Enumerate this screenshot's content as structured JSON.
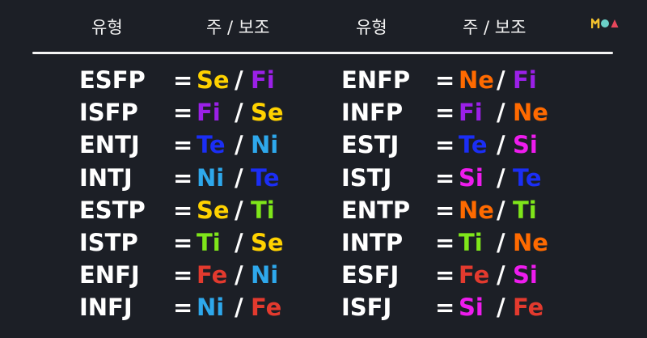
{
  "header": {
    "left_type_label": "유형",
    "left_func_label": "주 / 보조",
    "right_type_label": "유형",
    "right_func_label": "주 / 보조"
  },
  "logo": {
    "icon": "moa-logo-icon",
    "colors": [
      "#f2c12e",
      "#6bd0c8",
      "#e8475b"
    ]
  },
  "function_colors": {
    "Se": "#ffd200",
    "Si": "#ee1cee",
    "Ne": "#ff6a00",
    "Ni": "#2ea8ec",
    "Te": "#1b2ef5",
    "Ti": "#7fe61a",
    "Fe": "#e33a2e",
    "Fi": "#9b20e8"
  },
  "left_column": [
    {
      "type": "ESFP",
      "equals": "=",
      "primary": "Se",
      "separator": "/",
      "auxiliary": "Fi"
    },
    {
      "type": "ISFP",
      "equals": "=",
      "primary": "Fi",
      "separator": "/",
      "auxiliary": "Se"
    },
    {
      "type": "ENTJ",
      "equals": "=",
      "primary": "Te",
      "separator": "/",
      "auxiliary": "Ni"
    },
    {
      "type": "INTJ",
      "equals": "=",
      "primary": "Ni",
      "separator": "/",
      "auxiliary": "Te"
    },
    {
      "type": "ESTP",
      "equals": "=",
      "primary": "Se",
      "separator": "/",
      "auxiliary": "Ti"
    },
    {
      "type": "ISTP",
      "equals": "=",
      "primary": "Ti",
      "separator": "/",
      "auxiliary": "Se"
    },
    {
      "type": "ENFJ",
      "equals": "=",
      "primary": "Fe",
      "separator": "/",
      "auxiliary": "Ni"
    },
    {
      "type": "INFJ",
      "equals": "=",
      "primary": "Ni",
      "separator": "/",
      "auxiliary": "Fe"
    }
  ],
  "right_column": [
    {
      "type": "ENFP",
      "equals": "=",
      "primary": "Ne",
      "separator": "/",
      "auxiliary": "Fi"
    },
    {
      "type": "INFP",
      "equals": "=",
      "primary": "Fi",
      "separator": "/",
      "auxiliary": "Ne"
    },
    {
      "type": "ESTJ",
      "equals": "=",
      "primary": "Te",
      "separator": "/",
      "auxiliary": "Si"
    },
    {
      "type": "ISTJ",
      "equals": "=",
      "primary": "Si",
      "separator": "/",
      "auxiliary": "Te"
    },
    {
      "type": "ENTP",
      "equals": "=",
      "primary": "Ne",
      "separator": "/",
      "auxiliary": "Ti"
    },
    {
      "type": "INTP",
      "equals": "=",
      "primary": "Ti",
      "separator": "/",
      "auxiliary": "Ne"
    },
    {
      "type": "ESFJ",
      "equals": "=",
      "primary": "Fe",
      "separator": "/",
      "auxiliary": "Si"
    },
    {
      "type": "ISFJ",
      "equals": "=",
      "primary": "Si",
      "separator": "/",
      "auxiliary": "Fe"
    }
  ]
}
